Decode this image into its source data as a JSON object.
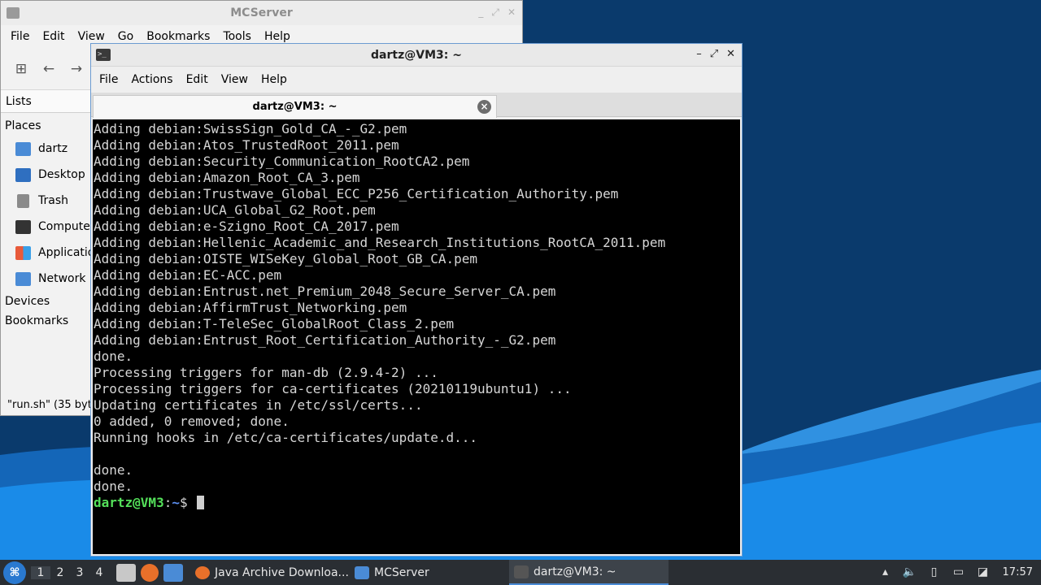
{
  "colors": {
    "wallpaper_dark": "#0a3a6c",
    "wallpaper_light": "#1a8be8",
    "taskbar": "#2a2e33",
    "terminal_bg": "#000000",
    "prompt_user": "#54e05a",
    "prompt_path": "#5c8ef0"
  },
  "file_manager": {
    "title": "MCServer",
    "menu": [
      "File",
      "Edit",
      "View",
      "Go",
      "Bookmarks",
      "Tools",
      "Help"
    ],
    "toolbar_icons": [
      "new-tab-icon",
      "back-arrow-icon",
      "forward-arrow-icon"
    ],
    "lists_label": "Lists",
    "places_label": "Places",
    "places": [
      {
        "label": "dartz",
        "icon": "home-folder-icon"
      },
      {
        "label": "Desktop",
        "icon": "desktop-icon"
      },
      {
        "label": "Trash",
        "icon": "trash-icon"
      },
      {
        "label": "Computer",
        "icon": "computer-icon"
      },
      {
        "label": "Applications",
        "icon": "applications-icon"
      },
      {
        "label": "Network",
        "icon": "network-icon"
      }
    ],
    "devices_label": "Devices",
    "bookmarks_label": "Bookmarks",
    "status": "\"run.sh\" (35 bytes)"
  },
  "terminal": {
    "title": "dartz@VM3: ~",
    "menu": [
      "File",
      "Actions",
      "Edit",
      "View",
      "Help"
    ],
    "tab_label": "dartz@VM3: ~",
    "lines": [
      "Adding debian:SwissSign_Gold_CA_-_G2.pem",
      "Adding debian:Atos_TrustedRoot_2011.pem",
      "Adding debian:Security_Communication_RootCA2.pem",
      "Adding debian:Amazon_Root_CA_3.pem",
      "Adding debian:Trustwave_Global_ECC_P256_Certification_Authority.pem",
      "Adding debian:UCA_Global_G2_Root.pem",
      "Adding debian:e-Szigno_Root_CA_2017.pem",
      "Adding debian:Hellenic_Academic_and_Research_Institutions_RootCA_2011.pem",
      "Adding debian:OISTE_WISeKey_Global_Root_GB_CA.pem",
      "Adding debian:EC-ACC.pem",
      "Adding debian:Entrust.net_Premium_2048_Secure_Server_CA.pem",
      "Adding debian:AffirmTrust_Networking.pem",
      "Adding debian:T-TeleSec_GlobalRoot_Class_2.pem",
      "Adding debian:Entrust_Root_Certification_Authority_-_G2.pem",
      "done.",
      "Processing triggers for man-db (2.9.4-2) ...",
      "Processing triggers for ca-certificates (20210119ubuntu1) ...",
      "Updating certificates in /etc/ssl/certs...",
      "0 added, 0 removed; done.",
      "Running hooks in /etc/ca-certificates/update.d...",
      "",
      "done.",
      "done."
    ],
    "prompt_user": "dartz@VM3",
    "prompt_sep": ":",
    "prompt_path": "~",
    "prompt_symbol": "$"
  },
  "taskbar": {
    "workspaces": [
      "1",
      "2",
      "3",
      "4"
    ],
    "active_workspace": "1",
    "quicklaunch": [
      {
        "name": "file-manager-icon",
        "color": "#c8c8c8"
      },
      {
        "name": "firefox-icon",
        "color": "#e8702a"
      },
      {
        "name": "show-desktop-icon",
        "color": "#4a8bd6"
      }
    ],
    "tasks": [
      {
        "label": "Java Archive Downloa...",
        "icon": "firefox-icon",
        "color": "#e8702a"
      },
      {
        "label": "MCServer",
        "icon": "folder-icon",
        "color": "#4a8bd6"
      },
      {
        "label": "dartz@VM3: ~",
        "icon": "terminal-icon",
        "color": "#555555"
      }
    ],
    "tray": [
      "tray-up-arrow-icon",
      "volume-icon",
      "clipboard-icon",
      "network-tray-icon",
      "updates-icon"
    ],
    "clock": "17:57"
  }
}
